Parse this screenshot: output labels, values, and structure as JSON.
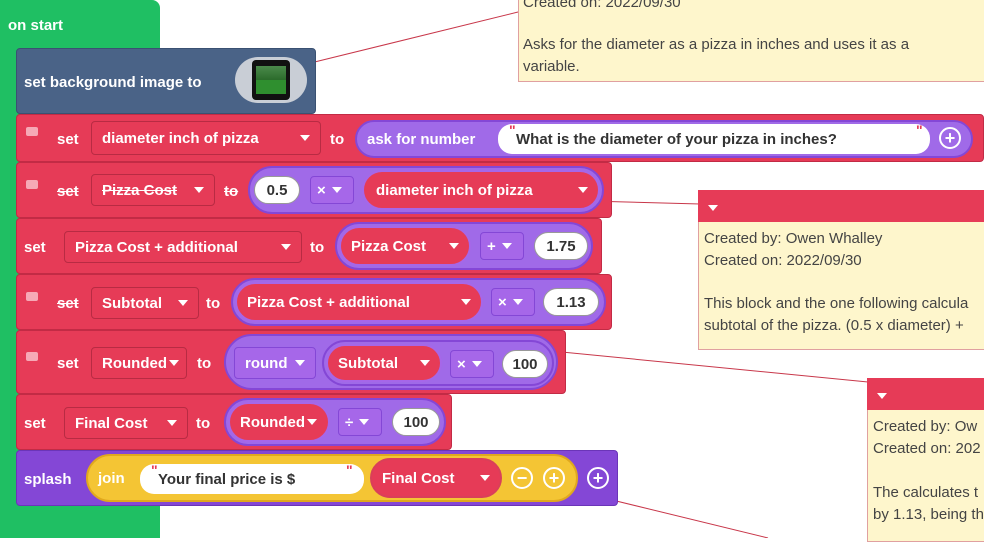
{
  "hat": {
    "label": "on start"
  },
  "bg_block": {
    "label": "set background image to"
  },
  "rows": {
    "r1": {
      "set": "set",
      "var": "diameter inch of pizza",
      "to": "to",
      "func": "ask for number",
      "prompt": "What is the diameter of your pizza in inches?"
    },
    "r2": {
      "set": "set",
      "var": "Pizza Cost",
      "to": "to",
      "num": "0.5",
      "op": "×",
      "ref": "diameter inch of pizza"
    },
    "r3": {
      "set": "set",
      "var": "Pizza Cost + additional",
      "to": "to",
      "ref": "Pizza Cost",
      "op": "+",
      "num": "1.75"
    },
    "r4": {
      "set": "set",
      "var": "Subtotal",
      "to": "to",
      "ref": "Pizza Cost + additional",
      "op": "×",
      "num": "1.13"
    },
    "r5": {
      "set": "set",
      "var": "Rounded",
      "to": "to",
      "func": "round",
      "ref": "Subtotal",
      "op": "×",
      "num": "100"
    },
    "r6": {
      "set": "set",
      "var": "Final Cost",
      "to": "to",
      "ref": "Rounded",
      "op": "÷",
      "num": "100"
    },
    "r7": {
      "splash": "splash",
      "join": "join",
      "text": "Your final price is $",
      "ref": "Final Cost"
    }
  },
  "notes": {
    "n1": {
      "created_on": "Created on: 2022/09/30",
      "body1": "Asks for the diameter as a pizza in inches and uses it as a",
      "body2": "variable."
    },
    "n2": {
      "created_by": "Created by: Owen Whalley",
      "created_on": "Created on: 2022/09/30",
      "body1": "This block and the one following calcula",
      "body2": "subtotal of the pizza. (0.5 x diameter) +"
    },
    "n3": {
      "created_by": "Created by: Ow",
      "created_on": "Created on: 202",
      "body1": "The calculates t",
      "body2": "by 1.13, being th"
    }
  }
}
